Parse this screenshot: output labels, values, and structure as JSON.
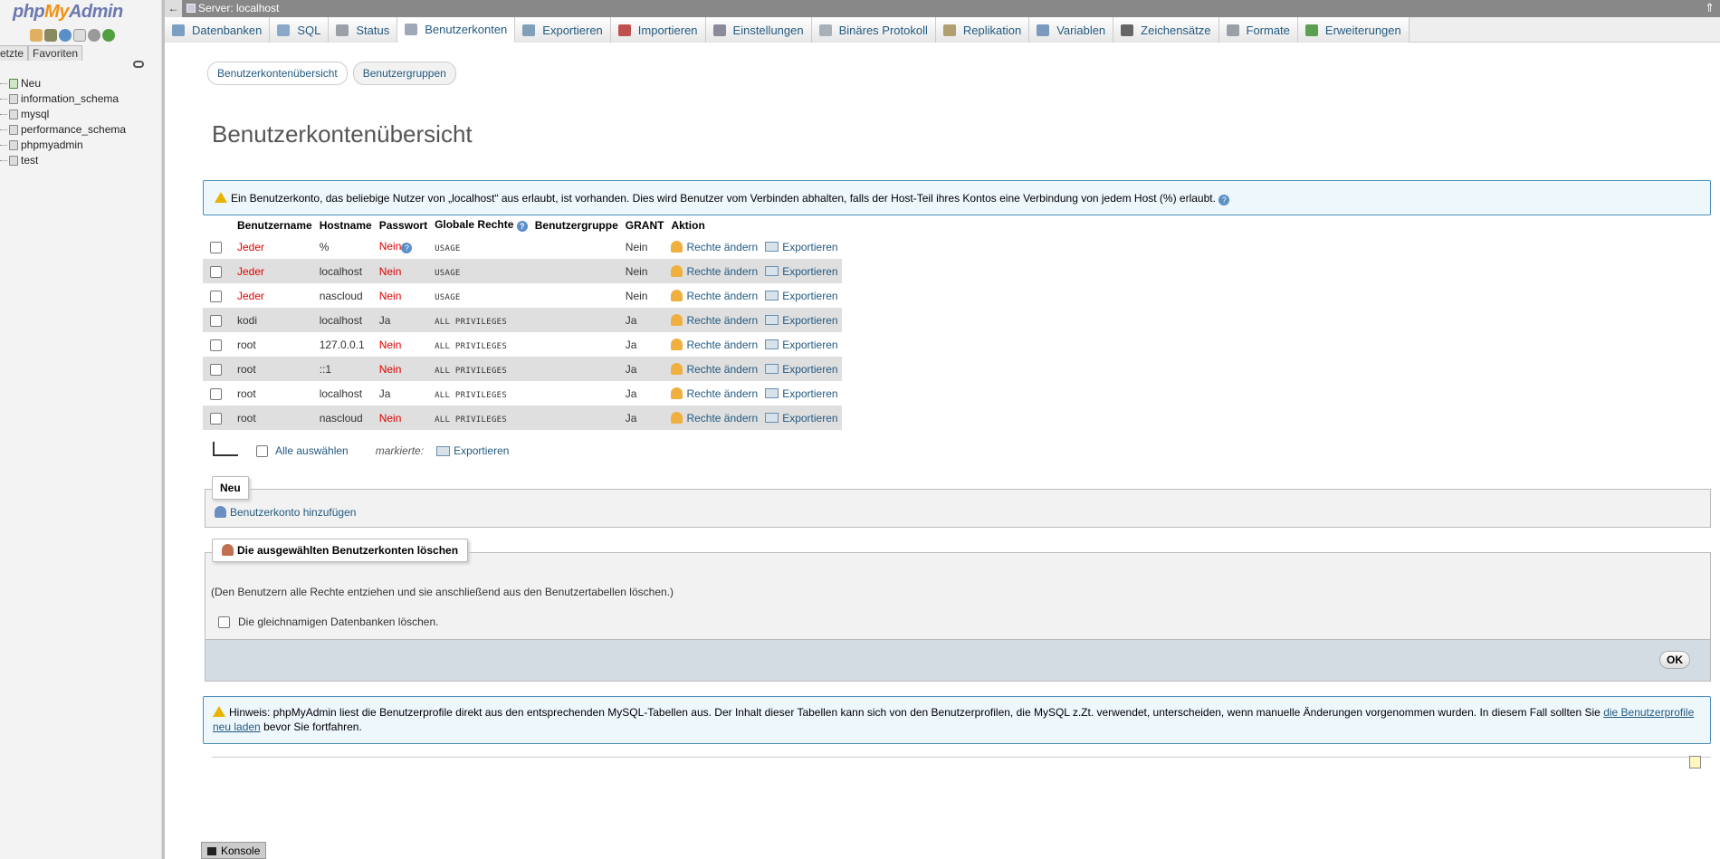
{
  "app": {
    "logo": {
      "php": "php",
      "my": "My",
      "admin": "Admin"
    },
    "server_breadcrumb": "Server: localhost"
  },
  "sidebar": {
    "tabs": [
      "etzte",
      "Favoriten"
    ],
    "databases": [
      "Neu",
      "information_schema",
      "mysql",
      "performance_schema",
      "phpmyadmin",
      "test"
    ]
  },
  "menu": [
    {
      "label": "Datenbanken",
      "icon": "database-icon",
      "color": "#7a9fc0"
    },
    {
      "label": "SQL",
      "icon": "sql-icon",
      "color": "#8aa8c8"
    },
    {
      "label": "Status",
      "icon": "status-icon",
      "color": "#9aa0a8"
    },
    {
      "label": "Benutzerkonten",
      "icon": "users-icon",
      "color": "#a0a8b8",
      "active": true
    },
    {
      "label": "Exportieren",
      "icon": "export-icon",
      "color": "#7fa0b8"
    },
    {
      "label": "Importieren",
      "icon": "import-icon",
      "color": "#c05050"
    },
    {
      "label": "Einstellungen",
      "icon": "wrench-icon",
      "color": "#8a8a9a"
    },
    {
      "label": "Binäres Protokoll",
      "icon": "binlog-icon",
      "color": "#a8b0b8"
    },
    {
      "label": "Replikation",
      "icon": "replication-icon",
      "color": "#b0a070"
    },
    {
      "label": "Variablen",
      "icon": "variables-icon",
      "color": "#7a9ac0"
    },
    {
      "label": "Zeichensätze",
      "icon": "charset-icon",
      "color": "#666666"
    },
    {
      "label": "Formate",
      "icon": "formats-icon",
      "color": "#9aa0a8"
    },
    {
      "label": "Erweiterungen",
      "icon": "plugins-icon",
      "color": "#5aa050"
    }
  ],
  "subtabs": [
    "Benutzerkontenübersicht",
    "Benutzergruppen"
  ],
  "page_title": "Benutzerkontenübersicht",
  "notice_top": "Ein Benutzerkonto, das beliebige Nutzer von „localhost“ aus erlaubt, ist vorhanden. Dies wird Benutzer vom Verbinden abhalten, falls der Host-Teil ihres Kontos eine Verbindung von jedem Host (%) erlaubt.",
  "table": {
    "headers": [
      "Benutzername",
      "Hostname",
      "Passwort",
      "Globale Rechte",
      "Benutzergruppe",
      "GRANT",
      "Aktion"
    ],
    "rows": [
      {
        "user": "Jeder",
        "host": "%",
        "password": "Nein",
        "priv": "USAGE",
        "group": "",
        "grant": "Nein"
      },
      {
        "user": "Jeder",
        "host": "localhost",
        "password": "Nein",
        "priv": "USAGE",
        "group": "",
        "grant": "Nein"
      },
      {
        "user": "Jeder",
        "host": "nascloud",
        "password": "Nein",
        "priv": "USAGE",
        "group": "",
        "grant": "Nein"
      },
      {
        "user": "kodi",
        "host": "localhost",
        "password": "Ja",
        "priv": "ALL PRIVILEGES",
        "group": "",
        "grant": "Ja"
      },
      {
        "user": "root",
        "host": "127.0.0.1",
        "password": "Nein",
        "priv": "ALL PRIVILEGES",
        "group": "",
        "grant": "Ja"
      },
      {
        "user": "root",
        "host": "::1",
        "password": "Nein",
        "priv": "ALL PRIVILEGES",
        "group": "",
        "grant": "Ja"
      },
      {
        "user": "root",
        "host": "localhost",
        "password": "Ja",
        "priv": "ALL PRIVILEGES",
        "group": "",
        "grant": "Ja"
      },
      {
        "user": "root",
        "host": "nascloud",
        "password": "Nein",
        "priv": "ALL PRIVILEGES",
        "group": "",
        "grant": "Ja"
      }
    ],
    "action_edit": "Rechte ändern",
    "action_export": "Exportieren"
  },
  "footer_actions": {
    "select_all": "Alle auswählen",
    "marked": "markierte:",
    "export": "Exportieren"
  },
  "new_section": {
    "legend": "Neu",
    "add_user": "Benutzerkonto hinzufügen"
  },
  "delete_section": {
    "legend": "Die ausgewählten Benutzerkonten löschen",
    "description": "(Den Benutzern alle Rechte entziehen und sie anschließend aus den Benutzertabellen löschen.)",
    "drop_db_label": "Die gleichnamigen Datenbanken löschen.",
    "ok_button": "OK"
  },
  "hint": {
    "before": "Hinweis: phpMyAdmin liest die Benutzerprofile direkt aus den entsprechenden MySQL-Tabellen aus. Der Inhalt dieser Tabellen kann sich von den Benutzerprofilen, die MySQL z.Zt. verwendet, unterscheiden, wenn manuelle Änderungen vorgenommen wurden. In diesem Fall sollten Sie",
    "link": "die Benutzerprofile neu laden",
    "after": "bevor Sie fortfahren."
  },
  "console": "Konsole"
}
